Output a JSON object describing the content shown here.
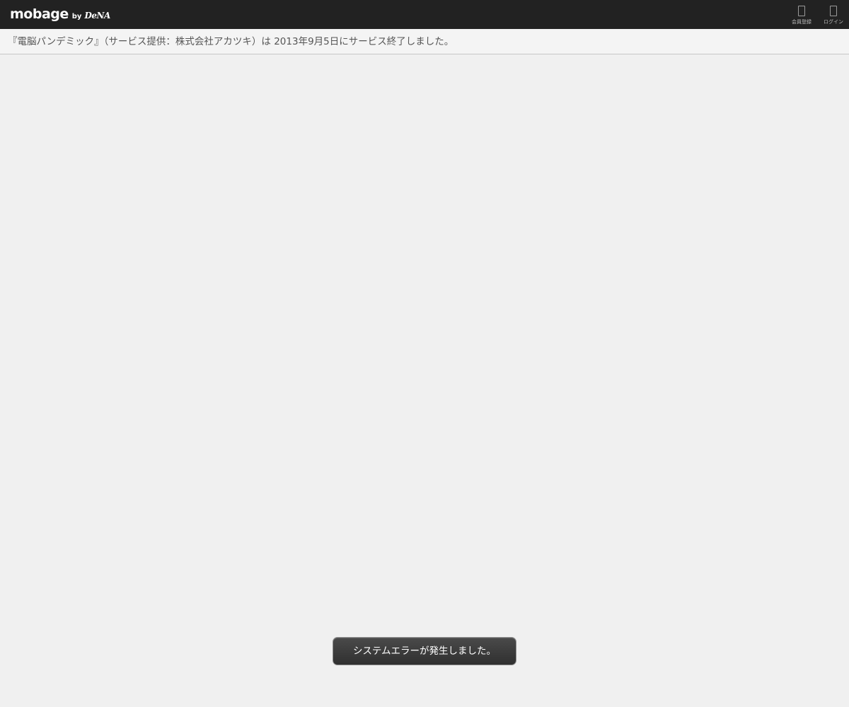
{
  "header": {
    "logo": {
      "main": "mobage",
      "by": "by",
      "brand": "DeNA"
    },
    "nav": [
      {
        "id": "register",
        "label": "会員登録",
        "icon": "phone-icon"
      },
      {
        "id": "login",
        "label": "ログイン",
        "icon": "phone-icon"
      }
    ]
  },
  "notice": {
    "text": "『電脳パンデミック』（サービス提供：株式会社アカツキ）は 2013年9月5日にサービス終了しました。"
  },
  "toast": {
    "message": "システムエラーが発生しました。"
  },
  "colors": {
    "topbar": "#222222",
    "background": "#f0f0f0",
    "toast_background": "#3a3a3a",
    "notice_text": "#555555"
  }
}
